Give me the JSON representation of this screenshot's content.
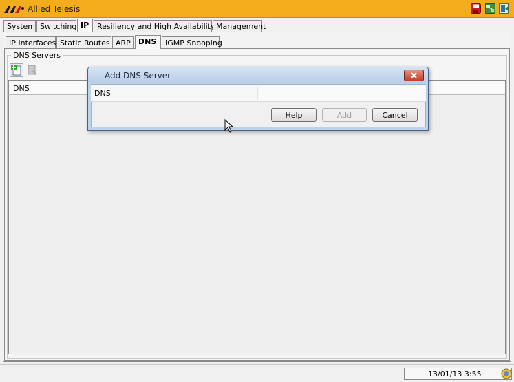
{
  "app": {
    "title": "Allied Telesis"
  },
  "top_tabs": [
    {
      "label": "System"
    },
    {
      "label": "Switching"
    },
    {
      "label": "IP"
    },
    {
      "label": "Resiliency and High Availability"
    },
    {
      "label": "Management"
    }
  ],
  "active_top_tab": "IP",
  "sub_tabs": [
    {
      "label": "IP Interfaces"
    },
    {
      "label": "Static Routes"
    },
    {
      "label": "ARP"
    },
    {
      "label": "DNS"
    },
    {
      "label": "IGMP Snooping"
    }
  ],
  "active_sub_tab": "DNS",
  "dns_servers": {
    "group_label": "DNS Servers",
    "toolbar": {
      "add_icon": "add-document-icon",
      "delete_icon": "delete-document-icon"
    },
    "table": {
      "columns": [
        "DNS"
      ],
      "rows": []
    }
  },
  "dialog": {
    "title": "Add DNS Server",
    "field_label": "DNS",
    "field_value": "",
    "buttons": {
      "help": "Help",
      "add": "Add",
      "cancel": "Cancel"
    }
  },
  "status": {
    "time": "13/01/13 3:55"
  },
  "colors": {
    "titlebar": "#f2ac1c",
    "dialog_frame": "#bdd3ec",
    "close_button": "#c0412a"
  }
}
